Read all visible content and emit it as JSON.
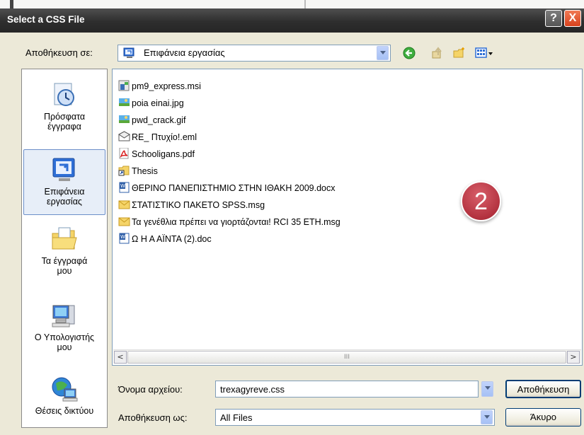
{
  "window": {
    "title": "Select a CSS File",
    "help_glyph": "?",
    "close_glyph": "X"
  },
  "save_in": {
    "label": "Αποθήκευση σε:",
    "value": "Επιφάνεια εργασίας"
  },
  "places": [
    {
      "label_line1": "Πρόσφατα",
      "label_line2": "έγγραφα",
      "icon": "recent-documents-icon"
    },
    {
      "label_line1": "Επιφάνεια",
      "label_line2": "εργασίας",
      "icon": "desktop-icon",
      "selected": true
    },
    {
      "label_line1": "Τα έγγραφά",
      "label_line2": "μου",
      "icon": "my-documents-icon"
    },
    {
      "label_line1": "Ο Υπολογιστής",
      "label_line2": "μου",
      "icon": "my-computer-icon"
    },
    {
      "label_line1": "Θέσεις δικτύου",
      "label_line2": "",
      "icon": "network-places-icon"
    }
  ],
  "files": [
    {
      "name": "pm9_express.msi",
      "icon": "installer-icon"
    },
    {
      "name": "poia einai.jpg",
      "icon": "image-icon"
    },
    {
      "name": "pwd_crack.gif",
      "icon": "image-icon"
    },
    {
      "name": "RE_ Πτυχίο!.eml",
      "icon": "email-icon"
    },
    {
      "name": "Schooligans.pdf",
      "icon": "pdf-icon"
    },
    {
      "name": "Thesis",
      "icon": "folder-shortcut-icon"
    },
    {
      "name": "ΘΕΡΙΝΟ ΠΑΝΕΠΙΣΤΗΜΙΟ ΣΤΗΝ ΙΘΑΚΗ 2009.docx",
      "icon": "word-document-icon"
    },
    {
      "name": "ΣΤΑΤΙΣΤΙΚΟ ΠΑΚΕΤΟ SPSS.msg",
      "icon": "mail-message-icon"
    },
    {
      "name": "Τα γενέθλια πρέπει να γιορτάζονται! RCI 35 ETH.msg",
      "icon": "mail-message-icon"
    },
    {
      "name": "Ω Η Α ΑΪΝΤΑ (2).doc",
      "icon": "word-document-icon"
    }
  ],
  "scrollbar": {
    "left_glyph": "<",
    "right_glyph": ">",
    "thumb_grip": "III"
  },
  "filename": {
    "label": "Όνομα αρχείου:",
    "value": "trexagyreve.css"
  },
  "save_as": {
    "label": "Αποθήκευση ως:",
    "value": "All Files"
  },
  "buttons": {
    "save": "Αποθήκευση",
    "cancel": "Άκυρο"
  },
  "annotation": {
    "badge_number": "2"
  },
  "colors": {
    "title_bar": "#2e2e2e",
    "close_button": "#d8421d",
    "badge": "#b3323f"
  }
}
